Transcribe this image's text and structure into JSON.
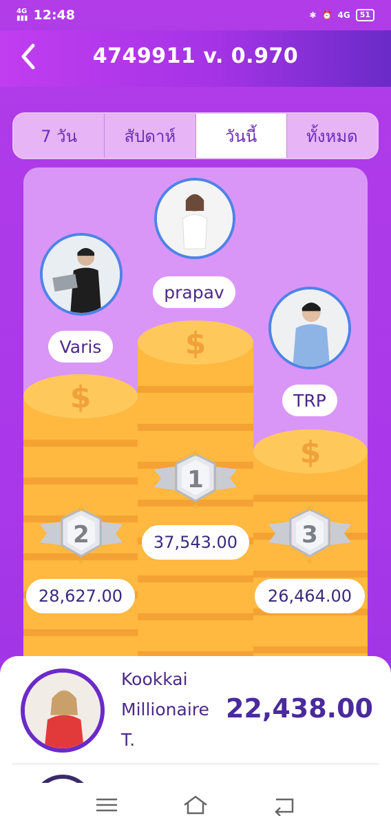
{
  "status_bar": {
    "time": "12:48",
    "network_left": "4G",
    "network_right": "4G",
    "battery": "51"
  },
  "header": {
    "title": "4749911 v. 0.970"
  },
  "tabs": [
    {
      "label": "7 วัน",
      "active": false
    },
    {
      "label": "สัปดาห์",
      "active": false
    },
    {
      "label": "วันนี้",
      "active": true
    },
    {
      "label": "ทั้งหมด",
      "active": false
    }
  ],
  "podium": {
    "first": {
      "rank": "1",
      "name": "prapav",
      "score": "37,543.00"
    },
    "second": {
      "rank": "2",
      "name": "Varis",
      "score": "28,627.00"
    },
    "third": {
      "rank": "3",
      "name": "TRP",
      "score": "26,464.00"
    }
  },
  "list": [
    {
      "name": "Kookkai Millionaire T.",
      "score": "22,438.00"
    }
  ],
  "colors": {
    "accent": "#6a2bc8",
    "coin": "#ffbf4a",
    "card": "#d996f7"
  }
}
